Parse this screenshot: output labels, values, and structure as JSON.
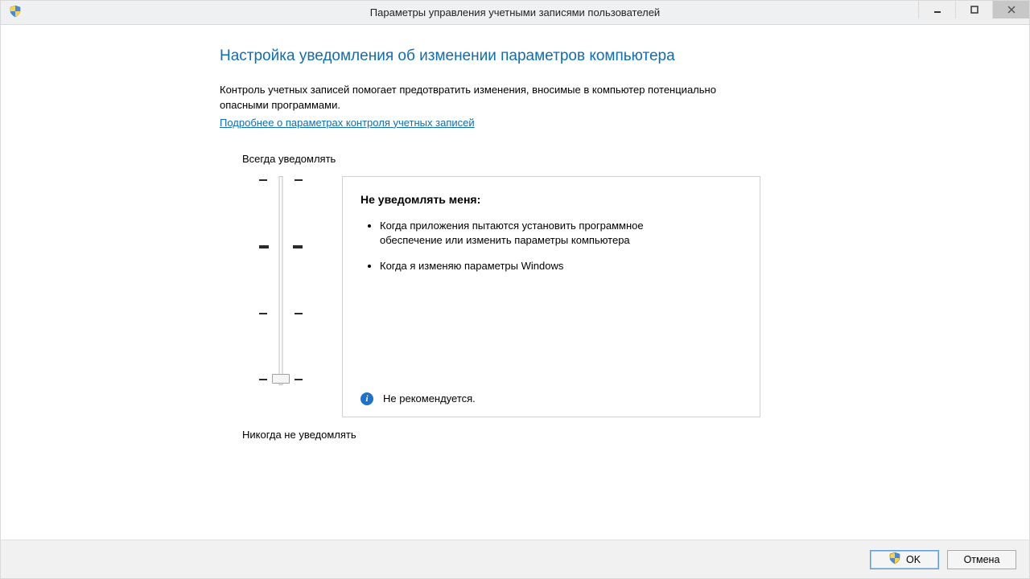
{
  "window": {
    "title": "Параметры управления учетными записями пользователей"
  },
  "content": {
    "heading": "Настройка уведомления об изменении параметров компьютера",
    "intro": "Контроль учетных записей помогает предотвратить изменения, вносимые в компьютер потенциально опасными программами.",
    "learn_more": "Подробнее о параметрах контроля учетных записей",
    "slider": {
      "top_label": "Всегда уведомлять",
      "bottom_label": "Никогда не уведомлять",
      "levels": 4,
      "current_level": 0
    },
    "info_box": {
      "title": "Не уведомлять меня:",
      "bullets": [
        "Когда приложения пытаются установить программное обеспечение или изменить параметры компьютера",
        "Когда я изменяю параметры Windows"
      ],
      "recommendation": "Не рекомендуется."
    }
  },
  "footer": {
    "ok": "OK",
    "cancel": "Отмена"
  }
}
